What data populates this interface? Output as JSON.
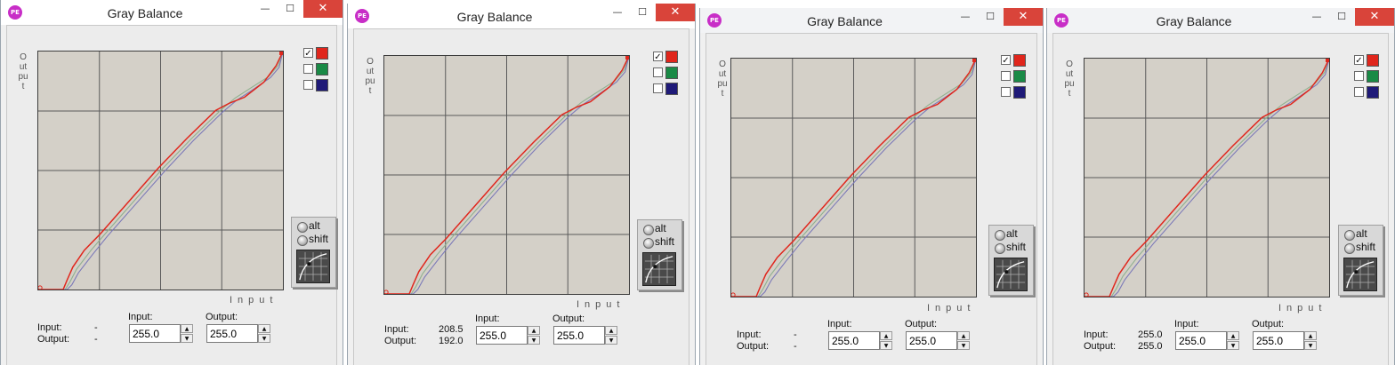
{
  "app_icon": "PE",
  "title": "Gray Balance",
  "controls": {
    "minimize": "—",
    "maximize": "☐",
    "close": "✕"
  },
  "axes": {
    "output": "Output",
    "input": "Input"
  },
  "channels": [
    {
      "name": "red",
      "color": "#e0261c",
      "checked": true
    },
    {
      "name": "green",
      "color": "#1a8a46",
      "checked": false
    },
    {
      "name": "blue",
      "color": "#1f1a78",
      "checked": false
    }
  ],
  "modifiers": {
    "alt": "alt",
    "shift": "shift"
  },
  "readout": {
    "input_label": "Input:",
    "output_label": "Output:"
  },
  "fields": {
    "input_label": "Input:",
    "output_label": "Output:"
  },
  "check_mark": "✓",
  "windows": [
    {
      "input_value": "-",
      "output_value": "-",
      "input_field": "255.0",
      "output_field": "255.0"
    },
    {
      "input_value": "208.5",
      "output_value": "192.0",
      "input_field": "255.0",
      "output_field": "255.0"
    },
    {
      "input_value": "-",
      "output_value": "-",
      "input_field": "255.0",
      "output_field": "255.0"
    },
    {
      "input_value": "255.0",
      "output_value": "255.0",
      "input_field": "255.0",
      "output_field": "255.0"
    }
  ],
  "chart_data": {
    "type": "line",
    "xlabel": "Input",
    "ylabel": "Output",
    "xlim": [
      0,
      255
    ],
    "ylim": [
      0,
      255
    ],
    "grid": true,
    "series": [
      {
        "color": "#8fb08f",
        "x": [
          0,
          28,
          33,
          40,
          55,
          70,
          100,
          130,
          160,
          190,
          205,
          220,
          240,
          250,
          255
        ],
        "y": [
          0,
          0,
          8,
          22,
          42,
          60,
          95,
          130,
          162,
          192,
          205,
          215,
          228,
          240,
          255
        ]
      },
      {
        "color": "#7b79b8",
        "x": [
          0,
          30,
          35,
          42,
          57,
          72,
          102,
          132,
          162,
          192,
          207,
          222,
          242,
          251,
          255
        ],
        "y": [
          0,
          0,
          5,
          18,
          38,
          57,
          92,
          127,
          160,
          190,
          203,
          213,
          227,
          238,
          255
        ]
      },
      {
        "color": "#e0261c",
        "x": [
          0,
          26,
          30,
          36,
          48,
          65,
          95,
          125,
          155,
          185,
          200,
          215,
          235,
          248,
          255
        ],
        "y": [
          0,
          0,
          10,
          24,
          42,
          60,
          95,
          130,
          162,
          192,
          200,
          206,
          222,
          240,
          255
        ]
      }
    ]
  }
}
